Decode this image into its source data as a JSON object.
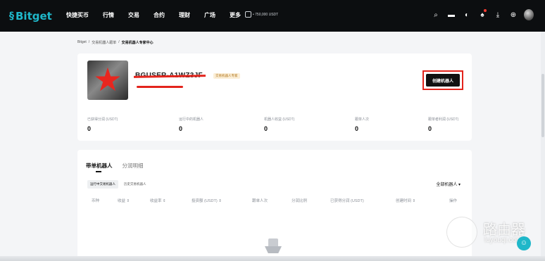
{
  "nav": {
    "logo": "Bitget",
    "items": [
      "快捷买币",
      "行情",
      "交易",
      "合约",
      "理财",
      "广场",
      "更多"
    ],
    "promo": "• 750,000 USDT",
    "icons": [
      "search-icon",
      "wallet-icon",
      "orders-icon",
      "bell-icon",
      "download-icon",
      "globe-icon"
    ]
  },
  "breadcrumb": {
    "home": "Bitget",
    "sep1": "/",
    "level2": "交易机器人跟单",
    "sep2": "/",
    "current": "交易机器人专家中心"
  },
  "profile": {
    "username": "BGUSER-A1WZ3JF",
    "badge": "交易机器人专家",
    "create_button": "创建机器人"
  },
  "stats": [
    {
      "label": "已获得分润 (USDT)",
      "value": "0"
    },
    {
      "label": "运行中的机器人",
      "value": "0"
    },
    {
      "label": "机器人收益 (USDT)",
      "value": "0"
    },
    {
      "label": "跟单人次",
      "value": "0"
    },
    {
      "label": "跟单者利润 (USDT)",
      "value": "0"
    }
  ],
  "list": {
    "tabs": [
      "带单机器人",
      "分润明细"
    ],
    "subtabs": [
      "运行中交易机器人",
      "历史交易机器人"
    ],
    "filter": "全部机器人 ▾",
    "columns": [
      "币种",
      "收益 ⇕",
      "收益率 ⇕",
      "投资额 (USDT) ⇕",
      "跟单人次",
      "分润比例",
      "已获得分润 (USDT)",
      "创建时间 ⇕",
      "操作"
    ]
  },
  "watermark": {
    "title": "路由器",
    "subtitle": "luyouqi.com"
  },
  "colors": {
    "brand": "#1fb7c9",
    "highlight": "#e3241c",
    "nav_bg": "#0c0e10"
  }
}
